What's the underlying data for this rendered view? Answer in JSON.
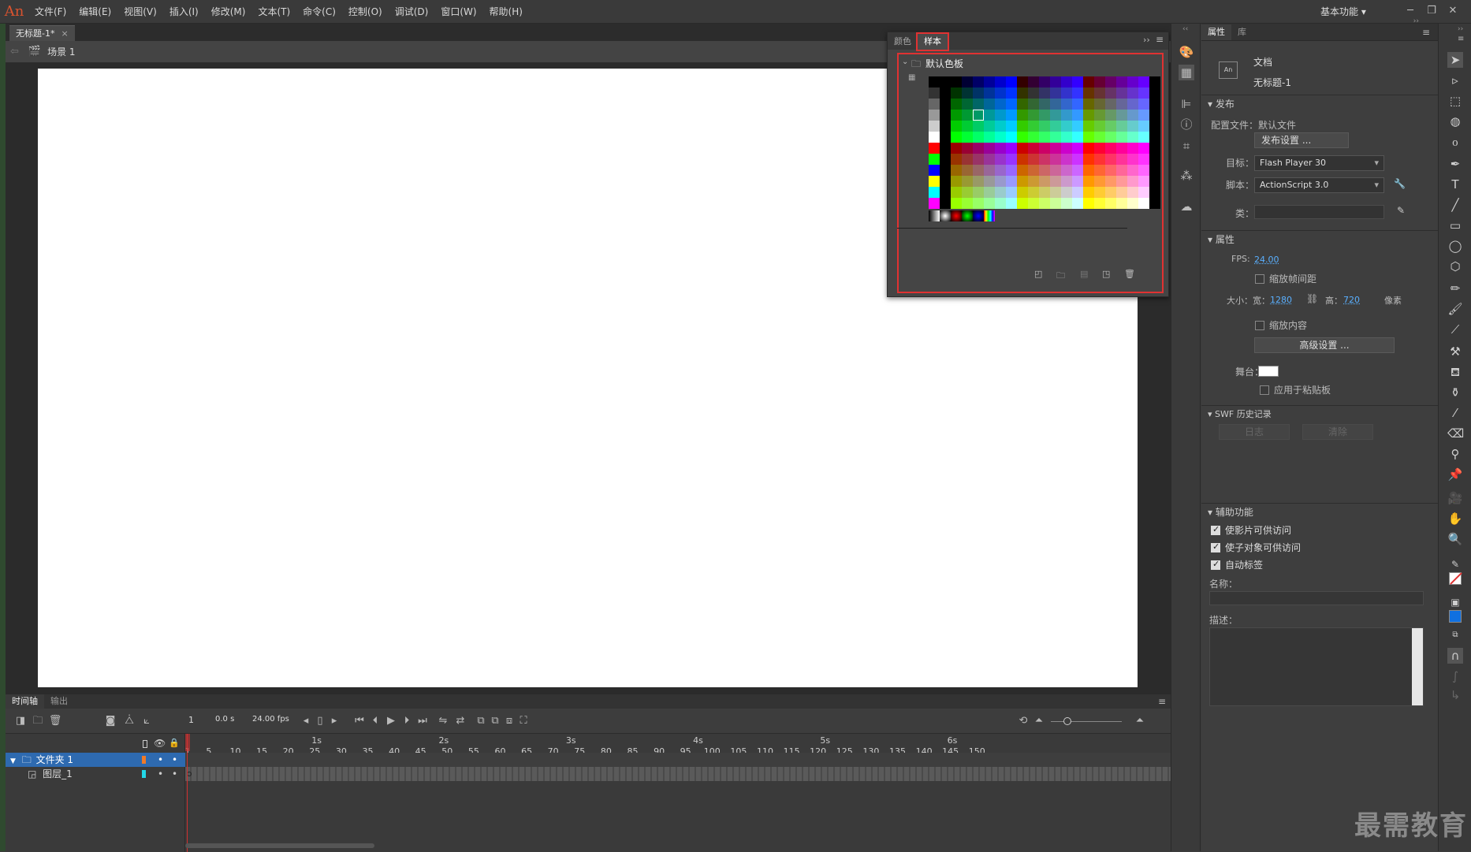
{
  "menubar": {
    "logo": "An",
    "items": [
      "文件(F)",
      "编辑(E)",
      "视图(V)",
      "插入(I)",
      "修改(M)",
      "文本(T)",
      "命令(C)",
      "控制(O)",
      "调试(D)",
      "窗口(W)",
      "帮助(H)"
    ],
    "workspace": "基本功能",
    "workspace_arrow": "▾"
  },
  "document": {
    "tab_title": "无标题-1*",
    "close": "×"
  },
  "scene": {
    "label": "场景 1"
  },
  "swatches_panel": {
    "tabs": [
      "颜色",
      "样本"
    ],
    "active_tab": "样本",
    "folder_label": "默认色板",
    "footer_icons": [
      "new-swatch-icon",
      "folder-icon",
      "duplicate-icon",
      "add-icon",
      "trash-icon"
    ]
  },
  "properties": {
    "tabs": [
      "属性",
      "库"
    ],
    "doc_type": "文档",
    "doc_name": "无标题-1",
    "publish_section": "发布",
    "profile_label": "配置文件：默认文件",
    "publish_settings_btn": "发布设置 ...",
    "target_label": "目标：",
    "target_value": "Flash Player 30",
    "script_label": "脚本：",
    "script_value": "ActionScript 3.0",
    "class_label": "类：",
    "props_section": "属性",
    "fps_label": "FPS:",
    "fps_value": "24.00",
    "scale_spans": "缩放帧间距",
    "size_label": "大小：宽：",
    "width_value": "1280",
    "height_label": "高：",
    "height_value": "720",
    "unit": "像素",
    "scale_content": "缩放内容",
    "advanced_btn": "高级设置 ...",
    "stage_label": "舞台：",
    "stage_color": "#ffffff",
    "apply_pasteboard": "应用于粘贴板",
    "swf_section": "SWF 历史记录",
    "log_btn": "日志",
    "clear_btn": "清除",
    "access_section": "辅助功能",
    "access_items": [
      "使影片可供访问",
      "使子对象可供访问",
      "自动标签"
    ],
    "name_label": "名称：",
    "desc_label": "描述："
  },
  "timeline": {
    "tabs": [
      "时间轴",
      "输出"
    ],
    "frame": "1",
    "time": "0.0 s",
    "fps": "24.00 fps",
    "seconds": [
      "1s",
      "2s",
      "3s",
      "4s",
      "5s",
      "6s"
    ],
    "frame_ticks": [
      "1",
      "5",
      "10",
      "15",
      "20",
      "25",
      "30",
      "35",
      "40",
      "45",
      "50",
      "55",
      "60",
      "65",
      "70",
      "75",
      "80",
      "85",
      "90",
      "95",
      "100",
      "105",
      "110",
      "115",
      "120",
      "125",
      "130",
      "135",
      "140",
      "145",
      "150"
    ],
    "layers": [
      {
        "name": "文件夹 1",
        "type": "folder",
        "color": "#f07a28"
      },
      {
        "name": "图层_1",
        "type": "layer",
        "color": "#22d8e8"
      }
    ]
  },
  "watermark": "最需教育"
}
